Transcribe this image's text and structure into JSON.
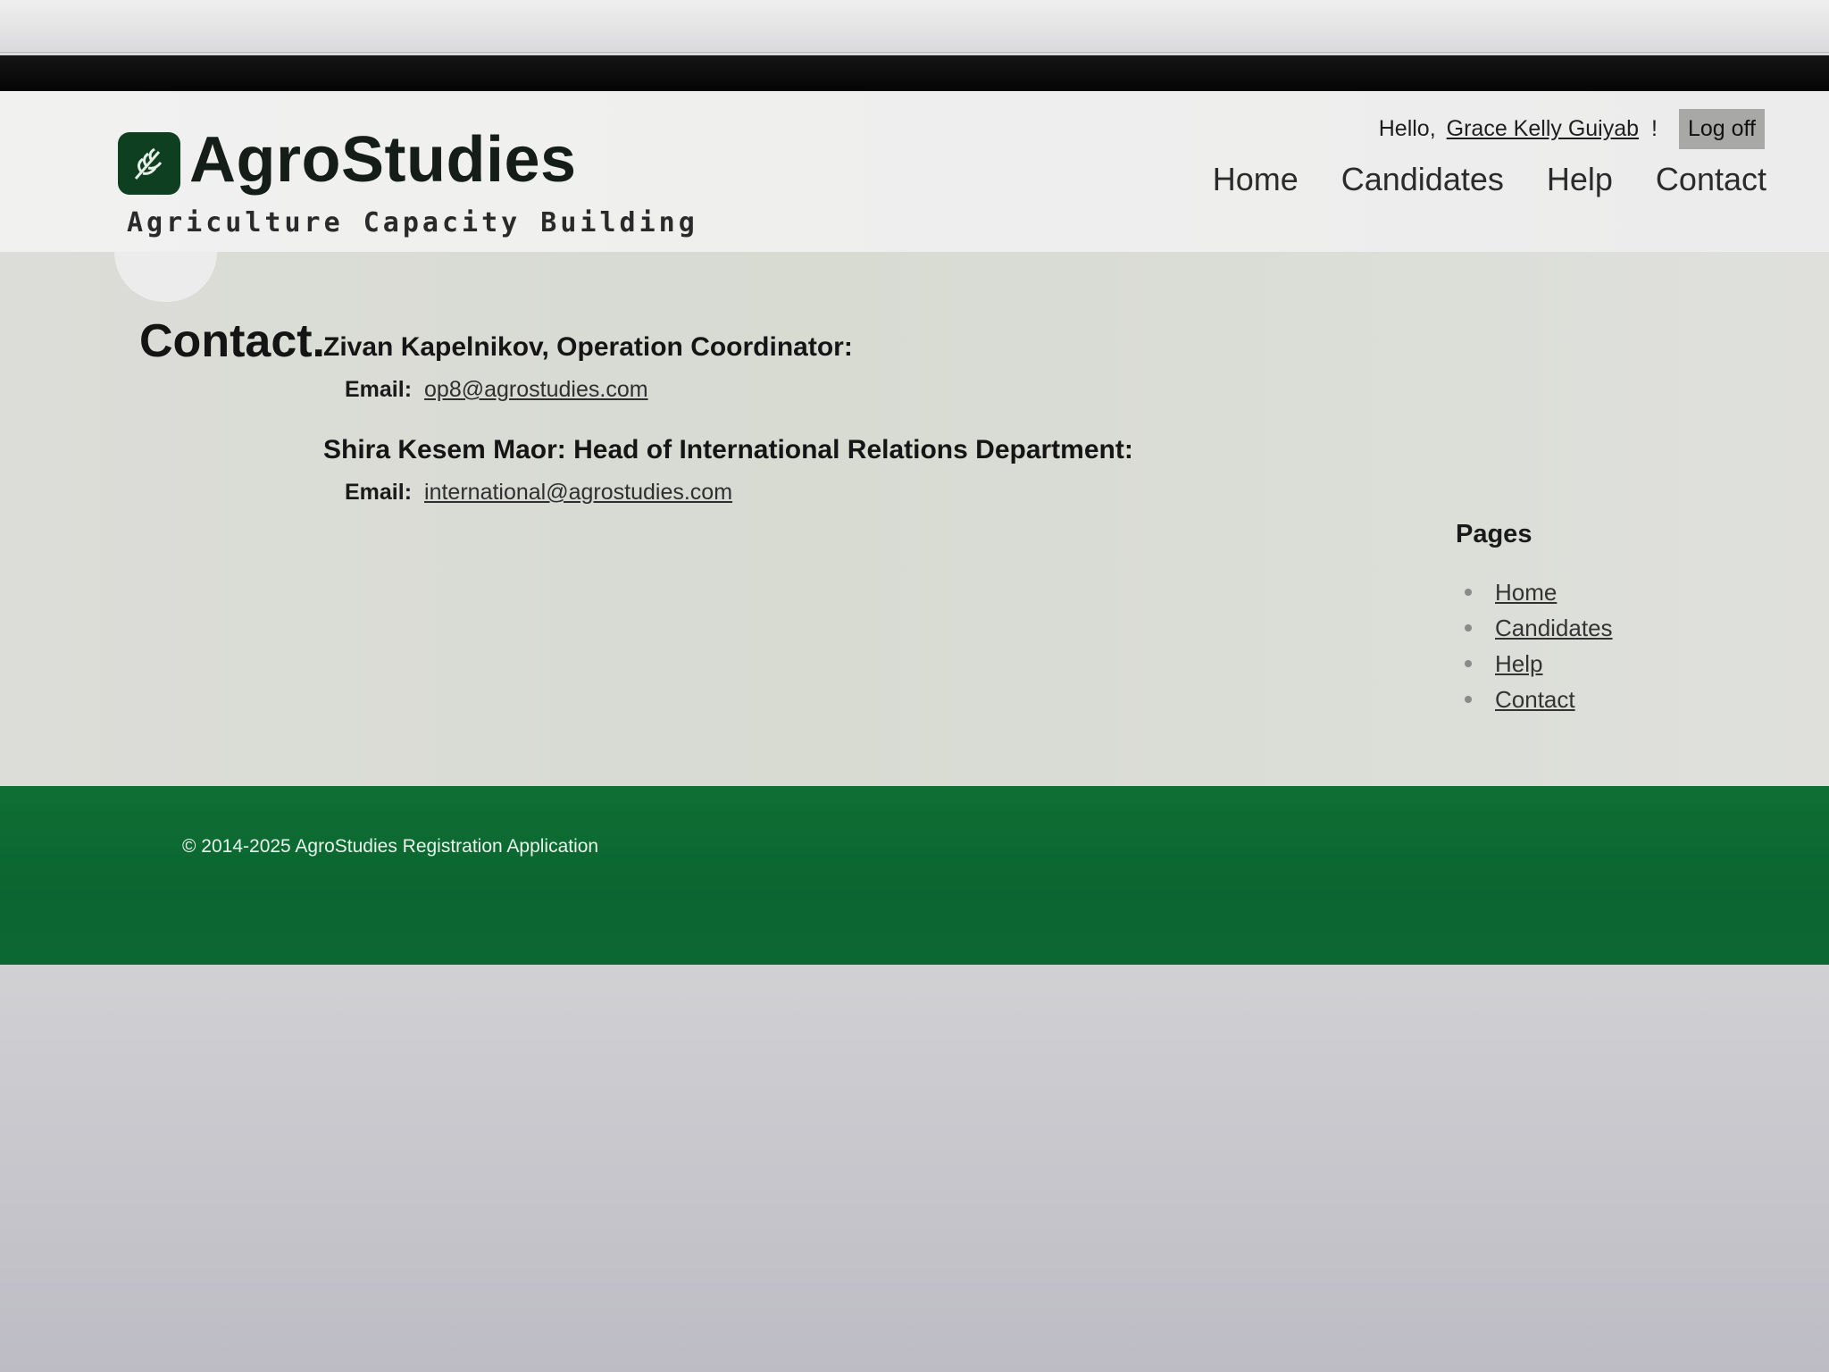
{
  "site": {
    "logo_name": "AgroStudies",
    "logo_tagline": "Agriculture Capacity Building",
    "brand_color": "#0e3f21"
  },
  "login": {
    "greeting": "Hello,",
    "user_name": "Grace Kelly Guiyab",
    "exclaim": "!",
    "logoff_label": "Log off"
  },
  "nav": {
    "items": [
      {
        "label": "Home"
      },
      {
        "label": "Candidates"
      },
      {
        "label": "Help"
      },
      {
        "label": "Contact"
      }
    ]
  },
  "main": {
    "title": "Contact.",
    "contacts": [
      {
        "name": "Zivan Kapelnikov, Operation Coordinator:",
        "email_label": "Email:",
        "email": "op8@agrostudies.com"
      },
      {
        "name": "Shira Kesem Maor: Head of International Relations Department:",
        "email_label": "Email:",
        "email": "international@agrostudies.com"
      }
    ]
  },
  "sidebar": {
    "heading": "Pages",
    "items": [
      {
        "label": "Home"
      },
      {
        "label": "Candidates"
      },
      {
        "label": "Help"
      },
      {
        "label": "Contact"
      }
    ]
  },
  "footer": {
    "copyright": "© 2014-2025 AgroStudies Registration Application",
    "color": "#0f6f34"
  }
}
